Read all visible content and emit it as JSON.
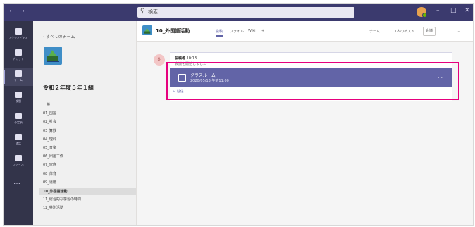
{
  "search": {
    "placeholder": "検索",
    "icon": "search-icon"
  },
  "window_controls": {
    "minimize": "–",
    "maximize": "□",
    "close": "✕"
  },
  "nav": {
    "back": "‹",
    "forward": "›"
  },
  "rail": {
    "items": [
      {
        "label": "アクティビティ",
        "icon": "bell-icon"
      },
      {
        "label": "チャット",
        "icon": "chat-icon"
      },
      {
        "label": "チーム",
        "icon": "teams-icon",
        "active": true
      },
      {
        "label": "課題",
        "icon": "assignments-icon"
      },
      {
        "label": "予定表",
        "icon": "calendar-icon"
      },
      {
        "label": "通話",
        "icon": "phone-icon"
      },
      {
        "label": "ファイル",
        "icon": "file-icon"
      }
    ],
    "more": "…"
  },
  "sidebar": {
    "back_label": "‹ すべてのチーム",
    "team_name": "令和２年度５年１組",
    "more": "…",
    "channels": [
      "一般",
      "01_国語",
      "02_社会",
      "03_算数",
      "04_理科",
      "05_音楽",
      "06_図画工作",
      "07_家庭",
      "08_体育",
      "09_道徳",
      "10_外国語活動",
      "11_総合的な学習の時間",
      "12_特別活動"
    ],
    "selected_index": 10
  },
  "header": {
    "title": "10_外国語活動",
    "tabs": [
      "投稿",
      "ファイル",
      "Wiki",
      "+"
    ],
    "active_tab": 0,
    "buttons": [
      "チーム",
      "1人のゲスト",
      "会議"
    ],
    "more": "…"
  },
  "post": {
    "avatar_text": "外",
    "author": "投稿者",
    "time": "10:13",
    "subtitle": "会議を開始しました",
    "meeting_title": "クラスルーム",
    "meeting_time": "2020/05/13 午前11:00",
    "reply": "↩ 返信",
    "more": "…"
  },
  "colors": {
    "accent": "#6264a7",
    "titlebar": "#3b3a6e",
    "rail": "#33344a",
    "highlight": "#e6007e"
  }
}
